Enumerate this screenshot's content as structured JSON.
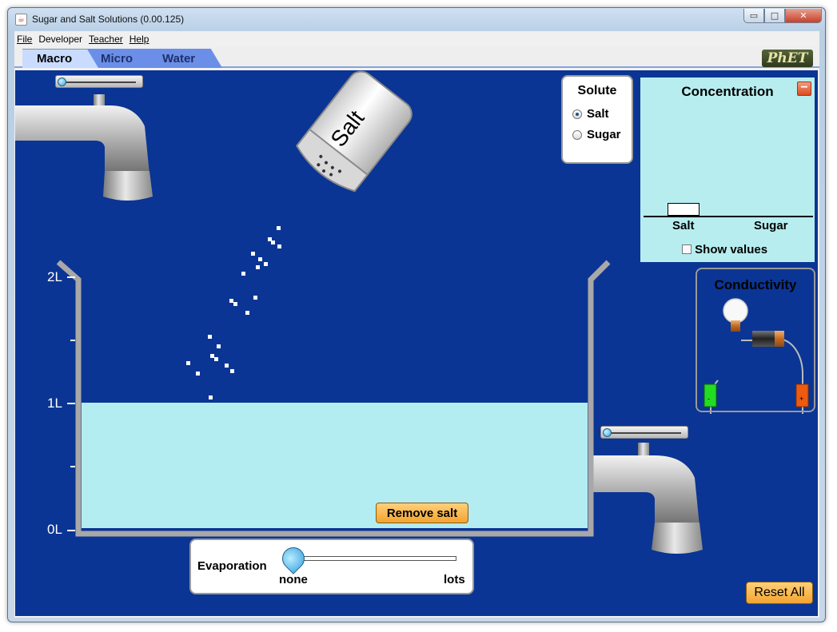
{
  "window": {
    "title": "Sugar and Salt Solutions (0.00.125)",
    "controls": {
      "minimize": "▭",
      "maximize": "□",
      "close": "✕"
    }
  },
  "menu": {
    "items": [
      {
        "label": "File"
      },
      {
        "label": "Developer"
      },
      {
        "label": "Teacher"
      },
      {
        "label": "Help"
      }
    ]
  },
  "tabs": [
    {
      "label": "Macro",
      "active": true
    },
    {
      "label": "Micro",
      "active": false
    },
    {
      "label": "Water",
      "active": false
    }
  ],
  "logo": "PhET",
  "shaker": {
    "label": "Salt"
  },
  "solute_panel": {
    "title": "Solute",
    "options": [
      {
        "label": "Salt",
        "selected": true
      },
      {
        "label": "Sugar",
        "selected": false
      }
    ]
  },
  "concentration_panel": {
    "title": "Concentration",
    "collapse_symbol": "−",
    "bar_labels": [
      "Salt",
      "Sugar"
    ],
    "show_values_label": "Show values",
    "show_values_checked": false
  },
  "conductivity_panel": {
    "title": "Conductivity",
    "negative_symbol": "-",
    "positive_symbol": "+"
  },
  "beaker": {
    "tick_labels": [
      "2L",
      "1L",
      "0L"
    ],
    "solution_volume_liters": 1
  },
  "remove_button": "Remove salt",
  "evaporation": {
    "label": "Evaporation",
    "min_label": "none",
    "max_label": "lots",
    "value": 0
  },
  "reset_button": "Reset All",
  "colors": {
    "background": "#0a3594",
    "solution": "#b3edf2",
    "concentration_panel": "#b8edf0",
    "orange_button": "#f3a430"
  }
}
